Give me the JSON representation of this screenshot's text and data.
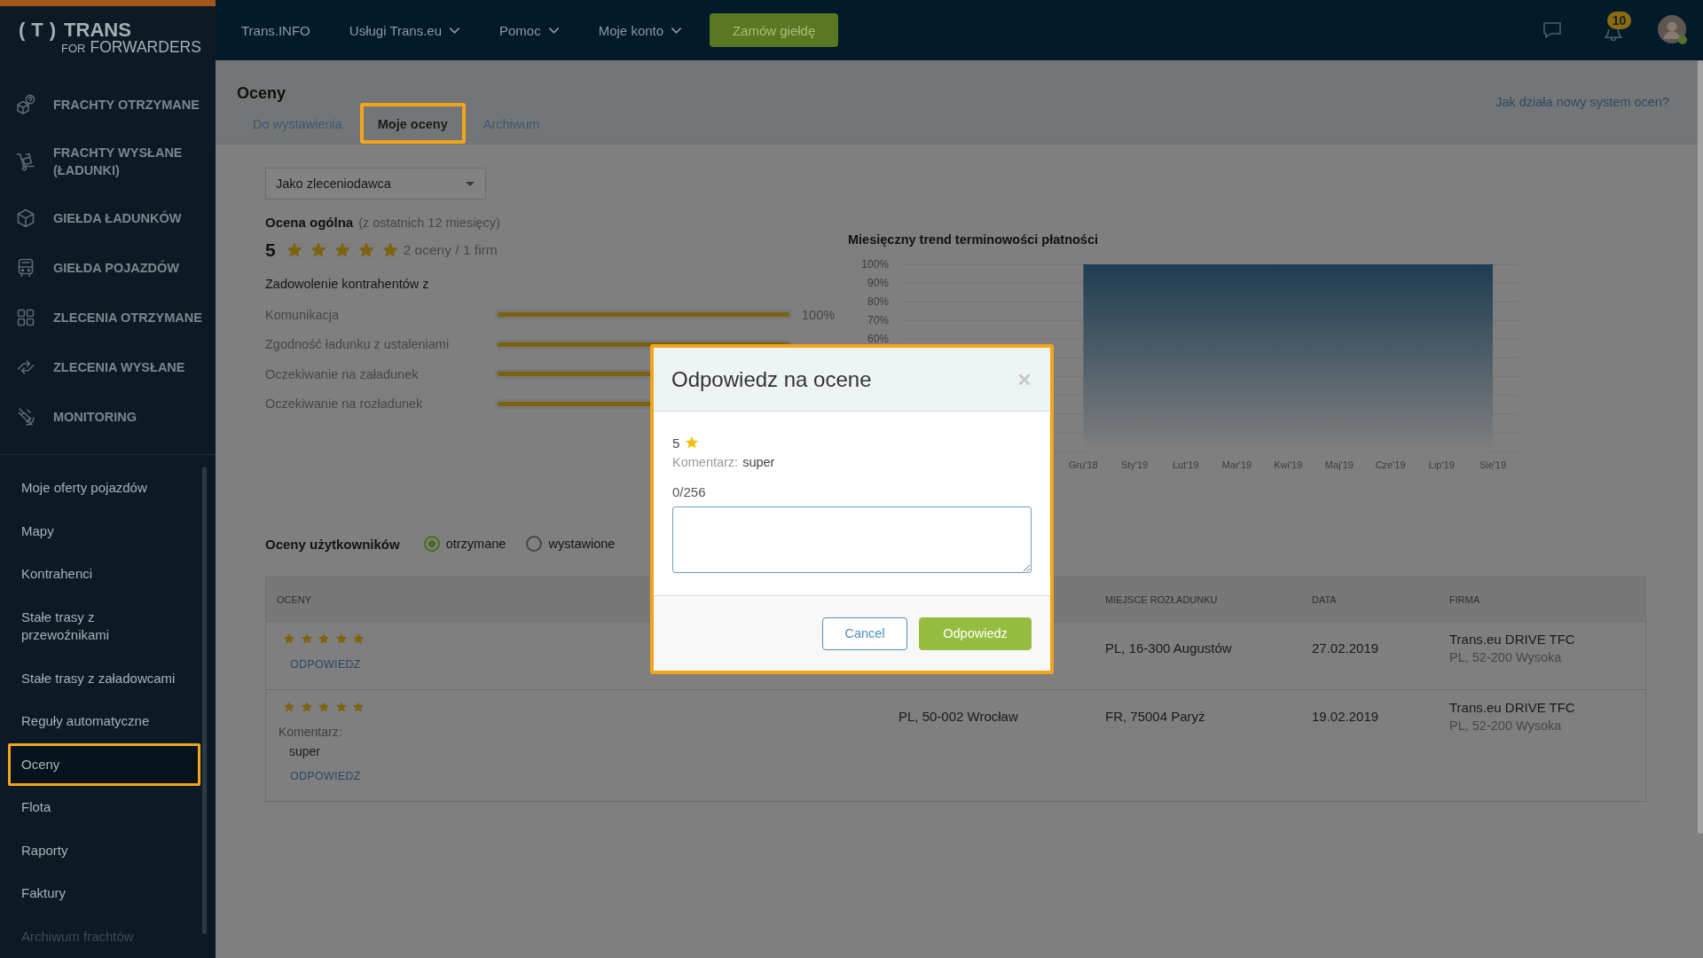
{
  "logo": {
    "mark": "(T)",
    "name": "TRANS",
    "tagline_prefix": "FOR",
    "tagline": "FORWARDERS"
  },
  "top_bar": {
    "nav": [
      {
        "label": "Trans.INFO",
        "dropdown": false
      },
      {
        "label": "Usługi Trans.eu",
        "dropdown": true
      },
      {
        "label": "Pomoc",
        "dropdown": true
      },
      {
        "label": "Moje konto",
        "dropdown": true
      }
    ],
    "order_button": "Zamów giełdę",
    "notification_count": "10"
  },
  "sidebar": {
    "main_items": [
      {
        "label": "FRACHTY OTRZYMANE",
        "selected": false
      },
      {
        "label": "FRACHTY WYSŁANE (ŁADUNKI)",
        "selected": false
      },
      {
        "label": "GIEŁDA ŁADUNKÓW",
        "selected": false
      },
      {
        "label": "GIEŁDA POJAZDÓW",
        "selected": false
      },
      {
        "label": "ZLECENIA OTRZYMANE",
        "selected": false
      },
      {
        "label": "ZLECENIA WYSŁANE",
        "selected": false
      },
      {
        "label": "MONITORING",
        "selected": false
      }
    ],
    "items": [
      {
        "label": "Moje oferty pojazdów",
        "selected": false,
        "disabled": false
      },
      {
        "label": "Mapy",
        "selected": false,
        "disabled": false
      },
      {
        "label": "Kontrahenci",
        "selected": false,
        "disabled": false
      },
      {
        "label": "Stałe trasy z przewoźnikami",
        "selected": false,
        "disabled": false
      },
      {
        "label": "Stałe trasy z załadowcami",
        "selected": false,
        "disabled": false
      },
      {
        "label": "Reguły automatyczne",
        "selected": false,
        "disabled": false
      },
      {
        "label": "Oceny",
        "selected": true,
        "disabled": false
      },
      {
        "label": "Flota",
        "selected": false,
        "disabled": false
      },
      {
        "label": "Raporty",
        "selected": false,
        "disabled": false
      },
      {
        "label": "Faktury",
        "selected": false,
        "disabled": false
      },
      {
        "label": "Archiwum frachtów",
        "selected": false,
        "disabled": true
      }
    ]
  },
  "page": {
    "title": "Oceny",
    "tabs": [
      {
        "label": "Do wystawienia",
        "selected": false
      },
      {
        "label": "Moje oceny",
        "selected": true
      },
      {
        "label": "Archiwum",
        "selected": false
      }
    ],
    "help_link": "Jak działa nowy system ocen?"
  },
  "summary": {
    "role_select": "Jako zleceniodawca",
    "overall_label": "Ocena ogólna",
    "overall_period": "(z ostatnich 12 miesięcy)",
    "score": "5",
    "stars": 5,
    "count_text": "2 oceny / 1 firm",
    "satisfaction_title": "Zadowolenie kontrahentów z",
    "criteria": [
      {
        "name": "Komunikacja",
        "level": 1,
        "reading": "100%"
      },
      {
        "name": "Zgodność ładunku z ustaleniami",
        "level": 1
      },
      {
        "name": "Oczekiwanie na załadunek",
        "level": 1
      },
      {
        "name": "Oczekiwanie na rozładunek",
        "level": 1
      }
    ]
  },
  "chart": {
    "chart_data": {
      "type": "area",
      "title": "Miesięczny trend terminowości płatności",
      "categories": [
        null,
        null,
        null,
        "Gru'18",
        "Sty'19",
        "Lut'19",
        "Mar'19",
        "Kwi'19",
        "Maj'19",
        "Cze'19",
        "Lip'19",
        "Sie'19"
      ],
      "series": [
        {
          "color": "#1f3d53",
          "values": [
            null,
            null,
            null,
            100,
            100,
            100,
            100,
            100,
            100,
            100,
            100,
            100
          ]
        }
      ],
      "ylim": [
        0,
        100
      ],
      "yticks": [
        {
          "value": 60,
          "label": "60%"
        },
        {
          "value": 70,
          "label": "70%"
        },
        {
          "value": 80,
          "label": "80%"
        },
        {
          "value": 90,
          "label": "90%"
        },
        {
          "value": 100,
          "label": "100%"
        }
      ],
      "grid": true
    }
  },
  "user_ratings": {
    "title": "Oceny użytkowników",
    "filters": [
      {
        "label": "otrzymane",
        "selected": true
      },
      {
        "label": "wystawione",
        "selected": false
      }
    ]
  },
  "table": {
    "columns": {
      "ratings": "OCENY",
      "unloading": "MIEJSCE ROZŁADUNKU",
      "date": "DATA",
      "company": "FIRMA"
    },
    "rows": [
      {
        "stars": 5,
        "reply_link": "ODPOWIEDZ",
        "unloading": "PL, 16-300 Augustów",
        "date": "27.02.2019",
        "company": "Trans.eu DRIVE TFC",
        "company_address": "PL, 52-200 Wysoka"
      },
      {
        "stars": 5,
        "comment_label": "Komentarz:",
        "comment": "super",
        "reply_link": "ODPOWIEDZ",
        "column_2": "PL, 50-002 Wrocław",
        "unloading": "FR, 75004 Paryż",
        "date": "19.02.2019",
        "company": "Trans.eu DRIVE TFC",
        "company_address": "PL, 52-200 Wysoka"
      }
    ]
  },
  "dialog": {
    "title": "Odpowiedz na ocene",
    "rating": "5",
    "comment_label": "Komentarz:",
    "comment": "super",
    "counter": "0/256",
    "buttons": [
      {
        "label": "Cancel",
        "kind": "secondary"
      },
      {
        "label": "Odpowiedz",
        "kind": "primary"
      }
    ]
  }
}
